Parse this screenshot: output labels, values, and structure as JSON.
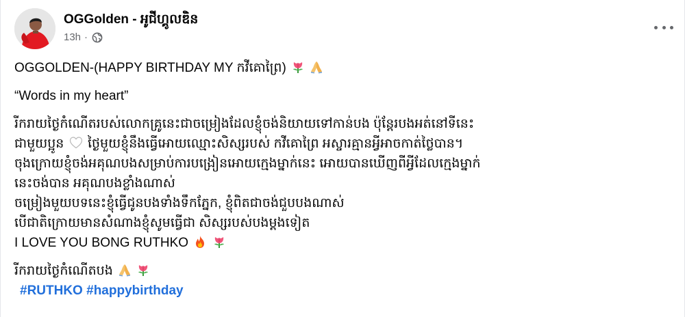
{
  "post": {
    "author": "OGGolden - អូជីហ្គូលឌិន",
    "time": "13h",
    "separator": "·",
    "privacy_icon": "globe-icon",
    "more_icon": "more-options-icon",
    "title_line": "OGGOLDEN-(HAPPY BIRTHDAY MY កវីគោព្រៃ)",
    "quote_line": "“Words in my heart”",
    "body_lines": [
      "រីករាយថ្ងៃកំណើតរបស់លោកគ្រូនេះជាចម្រៀងដែលខ្ញុំចង់និយាយទៅកាន់បង ប៉ុន្តែរបងអត់នៅទីនេះ",
      "ជាមួយប្អូន",
      "ថ្ងៃមួយខ្ញុំនឹងធ្វើអោយឈ្មោះសិស្សរបស់ កវីគោព្រៃ អស្ចារគ្មានអ្វីអាចកាត់ថ្លៃបាន។",
      "ចុងក្រោយខ្ញុំចង់អគុណបងសម្រាប់ការបង្រៀនអោយក្មេងម្នាក់នេះ អោយបានឃើញពីអ្វីដែលក្មេងម្នាក់",
      "នេះចង់បាន អគុណបងខ្លាំងណាស់",
      "ចម្រៀងមួយបទនេះខ្ញុំធ្វើជូនបងទាំងទឹកភ្នែក, ខ្ញុំពិតជាចង់ជួបបងណាស់",
      "បើជាតិក្រោយមានសំណាងខ្ញុំសូមធ្វើជា សិស្សរបស់បងម្តងទៀត",
      "I LOVE YOU BONG RUTHKO"
    ],
    "closing_line": "រីករាយថ្ងៃកំណើតបង",
    "hashtags": [
      "#RUTHKO",
      "#happybirthday"
    ],
    "emoji": [
      "tulip",
      "folded-hands",
      "white-heart",
      "fire"
    ]
  }
}
